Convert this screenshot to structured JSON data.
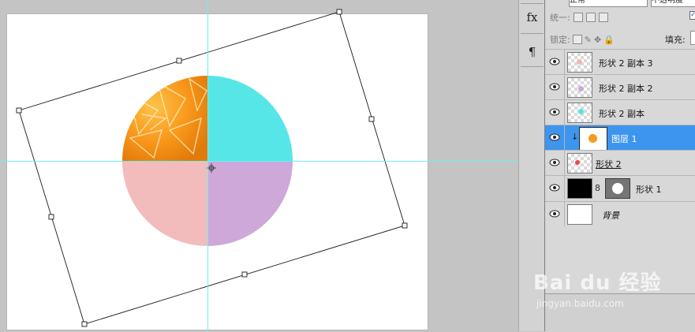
{
  "panel": {
    "blend_mode": "正常",
    "opacity_label": "不透明度",
    "unify_label": "统一:",
    "lock_label": "锁定:",
    "fill_label": "填充:",
    "layers": [
      {
        "name": "形状 2 副本 3",
        "thumb_dot_color": "#f3b9b9"
      },
      {
        "name": "形状 2 副本 2",
        "thumb_dot_color": "#cfaad8"
      },
      {
        "name": "形状 2 副本",
        "thumb_dot_color": "#56e6e8"
      },
      {
        "name": "图层 1",
        "thumb_dot_color": "#f59d1a"
      },
      {
        "name": "形状 2",
        "thumb_dot_color": "#e8494e"
      },
      {
        "name": "形状 1"
      },
      {
        "name": "背景"
      }
    ]
  },
  "tool_strip": {
    "buttons": [
      {
        "icon": "fx-icon",
        "glyph": "fx"
      },
      {
        "icon": "paragraph-icon",
        "glyph": "¶"
      }
    ]
  },
  "colors": {
    "orange": "#f7961a",
    "cyan": "#56e6e8",
    "pink": "#f3bcbc",
    "purple": "#cda8d8",
    "guide": "#6ff0f0",
    "selection": "#3d95ee"
  },
  "watermark": {
    "text": "Bai du 经验",
    "sub": "jingyan.baidu.com"
  }
}
